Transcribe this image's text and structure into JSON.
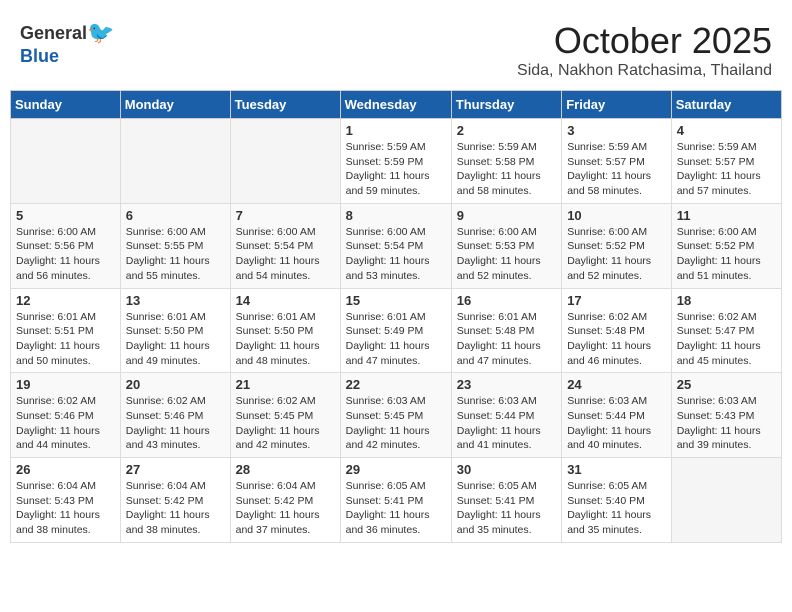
{
  "header": {
    "logo_general": "General",
    "logo_blue": "Blue",
    "month": "October 2025",
    "location": "Sida, Nakhon Ratchasima, Thailand"
  },
  "days_of_week": [
    "Sunday",
    "Monday",
    "Tuesday",
    "Wednesday",
    "Thursday",
    "Friday",
    "Saturday"
  ],
  "weeks": [
    [
      {
        "day": "",
        "info": ""
      },
      {
        "day": "",
        "info": ""
      },
      {
        "day": "",
        "info": ""
      },
      {
        "day": "1",
        "info": "Sunrise: 5:59 AM\nSunset: 5:59 PM\nDaylight: 11 hours\nand 59 minutes."
      },
      {
        "day": "2",
        "info": "Sunrise: 5:59 AM\nSunset: 5:58 PM\nDaylight: 11 hours\nand 58 minutes."
      },
      {
        "day": "3",
        "info": "Sunrise: 5:59 AM\nSunset: 5:57 PM\nDaylight: 11 hours\nand 58 minutes."
      },
      {
        "day": "4",
        "info": "Sunrise: 5:59 AM\nSunset: 5:57 PM\nDaylight: 11 hours\nand 57 minutes."
      }
    ],
    [
      {
        "day": "5",
        "info": "Sunrise: 6:00 AM\nSunset: 5:56 PM\nDaylight: 11 hours\nand 56 minutes."
      },
      {
        "day": "6",
        "info": "Sunrise: 6:00 AM\nSunset: 5:55 PM\nDaylight: 11 hours\nand 55 minutes."
      },
      {
        "day": "7",
        "info": "Sunrise: 6:00 AM\nSunset: 5:54 PM\nDaylight: 11 hours\nand 54 minutes."
      },
      {
        "day": "8",
        "info": "Sunrise: 6:00 AM\nSunset: 5:54 PM\nDaylight: 11 hours\nand 53 minutes."
      },
      {
        "day": "9",
        "info": "Sunrise: 6:00 AM\nSunset: 5:53 PM\nDaylight: 11 hours\nand 52 minutes."
      },
      {
        "day": "10",
        "info": "Sunrise: 6:00 AM\nSunset: 5:52 PM\nDaylight: 11 hours\nand 52 minutes."
      },
      {
        "day": "11",
        "info": "Sunrise: 6:00 AM\nSunset: 5:52 PM\nDaylight: 11 hours\nand 51 minutes."
      }
    ],
    [
      {
        "day": "12",
        "info": "Sunrise: 6:01 AM\nSunset: 5:51 PM\nDaylight: 11 hours\nand 50 minutes."
      },
      {
        "day": "13",
        "info": "Sunrise: 6:01 AM\nSunset: 5:50 PM\nDaylight: 11 hours\nand 49 minutes."
      },
      {
        "day": "14",
        "info": "Sunrise: 6:01 AM\nSunset: 5:50 PM\nDaylight: 11 hours\nand 48 minutes."
      },
      {
        "day": "15",
        "info": "Sunrise: 6:01 AM\nSunset: 5:49 PM\nDaylight: 11 hours\nand 47 minutes."
      },
      {
        "day": "16",
        "info": "Sunrise: 6:01 AM\nSunset: 5:48 PM\nDaylight: 11 hours\nand 47 minutes."
      },
      {
        "day": "17",
        "info": "Sunrise: 6:02 AM\nSunset: 5:48 PM\nDaylight: 11 hours\nand 46 minutes."
      },
      {
        "day": "18",
        "info": "Sunrise: 6:02 AM\nSunset: 5:47 PM\nDaylight: 11 hours\nand 45 minutes."
      }
    ],
    [
      {
        "day": "19",
        "info": "Sunrise: 6:02 AM\nSunset: 5:46 PM\nDaylight: 11 hours\nand 44 minutes."
      },
      {
        "day": "20",
        "info": "Sunrise: 6:02 AM\nSunset: 5:46 PM\nDaylight: 11 hours\nand 43 minutes."
      },
      {
        "day": "21",
        "info": "Sunrise: 6:02 AM\nSunset: 5:45 PM\nDaylight: 11 hours\nand 42 minutes."
      },
      {
        "day": "22",
        "info": "Sunrise: 6:03 AM\nSunset: 5:45 PM\nDaylight: 11 hours\nand 42 minutes."
      },
      {
        "day": "23",
        "info": "Sunrise: 6:03 AM\nSunset: 5:44 PM\nDaylight: 11 hours\nand 41 minutes."
      },
      {
        "day": "24",
        "info": "Sunrise: 6:03 AM\nSunset: 5:44 PM\nDaylight: 11 hours\nand 40 minutes."
      },
      {
        "day": "25",
        "info": "Sunrise: 6:03 AM\nSunset: 5:43 PM\nDaylight: 11 hours\nand 39 minutes."
      }
    ],
    [
      {
        "day": "26",
        "info": "Sunrise: 6:04 AM\nSunset: 5:43 PM\nDaylight: 11 hours\nand 38 minutes."
      },
      {
        "day": "27",
        "info": "Sunrise: 6:04 AM\nSunset: 5:42 PM\nDaylight: 11 hours\nand 38 minutes."
      },
      {
        "day": "28",
        "info": "Sunrise: 6:04 AM\nSunset: 5:42 PM\nDaylight: 11 hours\nand 37 minutes."
      },
      {
        "day": "29",
        "info": "Sunrise: 6:05 AM\nSunset: 5:41 PM\nDaylight: 11 hours\nand 36 minutes."
      },
      {
        "day": "30",
        "info": "Sunrise: 6:05 AM\nSunset: 5:41 PM\nDaylight: 11 hours\nand 35 minutes."
      },
      {
        "day": "31",
        "info": "Sunrise: 6:05 AM\nSunset: 5:40 PM\nDaylight: 11 hours\nand 35 minutes."
      },
      {
        "day": "",
        "info": ""
      }
    ]
  ]
}
